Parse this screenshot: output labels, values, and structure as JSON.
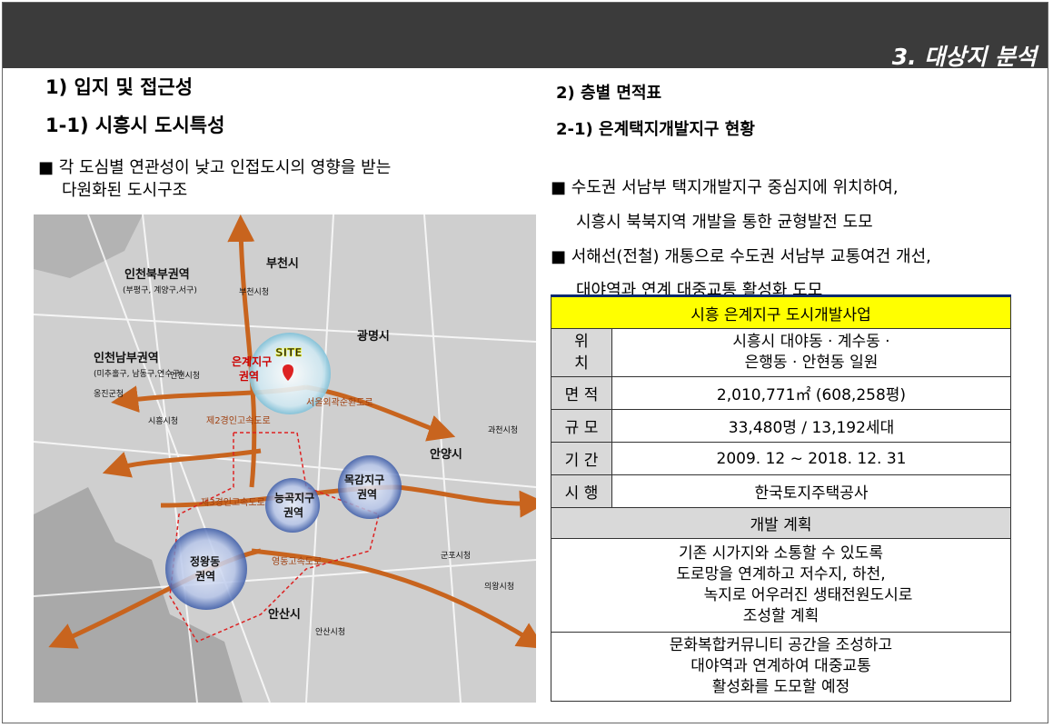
{
  "header": {
    "section_title": "3. 대상지 분석"
  },
  "left": {
    "h1": "1) 입지 및 접근성",
    "h2": "1-1) 시흥시 도시특성",
    "bullet_line1": "■ 각 도심별 연관성이 낮고 인접도시의 영향을 받는",
    "bullet_line2": "다원화된 도시구조"
  },
  "right": {
    "h1": "2) 층별 면적표",
    "h2": "2-1) 은계택지개발지구 현황",
    "bullets": [
      "■ 수도권 서남부 택지개발지구 중심지에 위치하여,",
      "시흥시 북북지역 개발을 통한 균형발전 도모",
      "■ 서해선(전철) 개통으로 수도권 서남부 교통여건 개선,",
      "대야역과 연계 대중교통 활성화 도모"
    ]
  },
  "map": {
    "labels": {
      "incheon_north": "인천북부권역",
      "incheon_north_sub": "(부평구, 계양구,서구)",
      "bucheon": "부천시",
      "bucheon_hall": "부천시청",
      "gwangmyeong": "광명시",
      "incheon_south": "인천남부권역",
      "incheon_south_sub": "(미추홀구, 남동구,연수구)",
      "ongjin": "옹진군청",
      "incheon_hall": "인천시청",
      "site": "SITE",
      "eungye": "은계지구",
      "eungye2": "권역",
      "road1": "제2경인고속도로",
      "road2": "제3경인고속도로",
      "road3": "영동고속도로",
      "road4": "서울외곽순환도로",
      "neunggok": "능곡지구",
      "neunggok2": "권역",
      "mokgam": "목감지구",
      "mokgam2": "권역",
      "anyang": "안양시",
      "gwacheon": "과천시청",
      "gunpo": "군포시청",
      "uiwang": "의왕시청",
      "jeongwang": "정왕동",
      "jeongwang2": "권역",
      "ansan": "안산시",
      "ansan_hall": "안산시청",
      "siheung_hall": "시흥시청"
    }
  },
  "table": {
    "header": "시흥 은계지구 도시개발사업",
    "rows": [
      {
        "label": "위\n치",
        "value_line1": "시흥시 대야동 · 계수동 ·",
        "value_line2": "은행동 · 안현동 일원"
      },
      {
        "label": "면 적",
        "value": "2,010,771㎡  (608,258평)"
      },
      {
        "label": "규 모",
        "value": "33,480명   /   13,192세대"
      },
      {
        "label": "기 간",
        "value": "2009. 12   ~   2018. 12. 31"
      },
      {
        "label": "시 행",
        "value": "한국토지주택공사"
      }
    ],
    "plan_header": "개발 계획",
    "plan_block1": [
      "기존 시가지와 소통할 수 있도록",
      "도로망을 연계하고 저수지, 하천,",
      "녹지로 어우러진 생태전원도시로",
      "조성할 계획"
    ],
    "plan_block2": [
      "문화복합커뮤니티 공간을 조성하고",
      "대야역과 연계하여 대중교통",
      "활성화를 도모할 예정"
    ]
  },
  "colors": {
    "topbar": "#3b3b3b",
    "table_header": "#ffff00",
    "arrow": "#c8641e",
    "circle": "#3a5aa8"
  }
}
